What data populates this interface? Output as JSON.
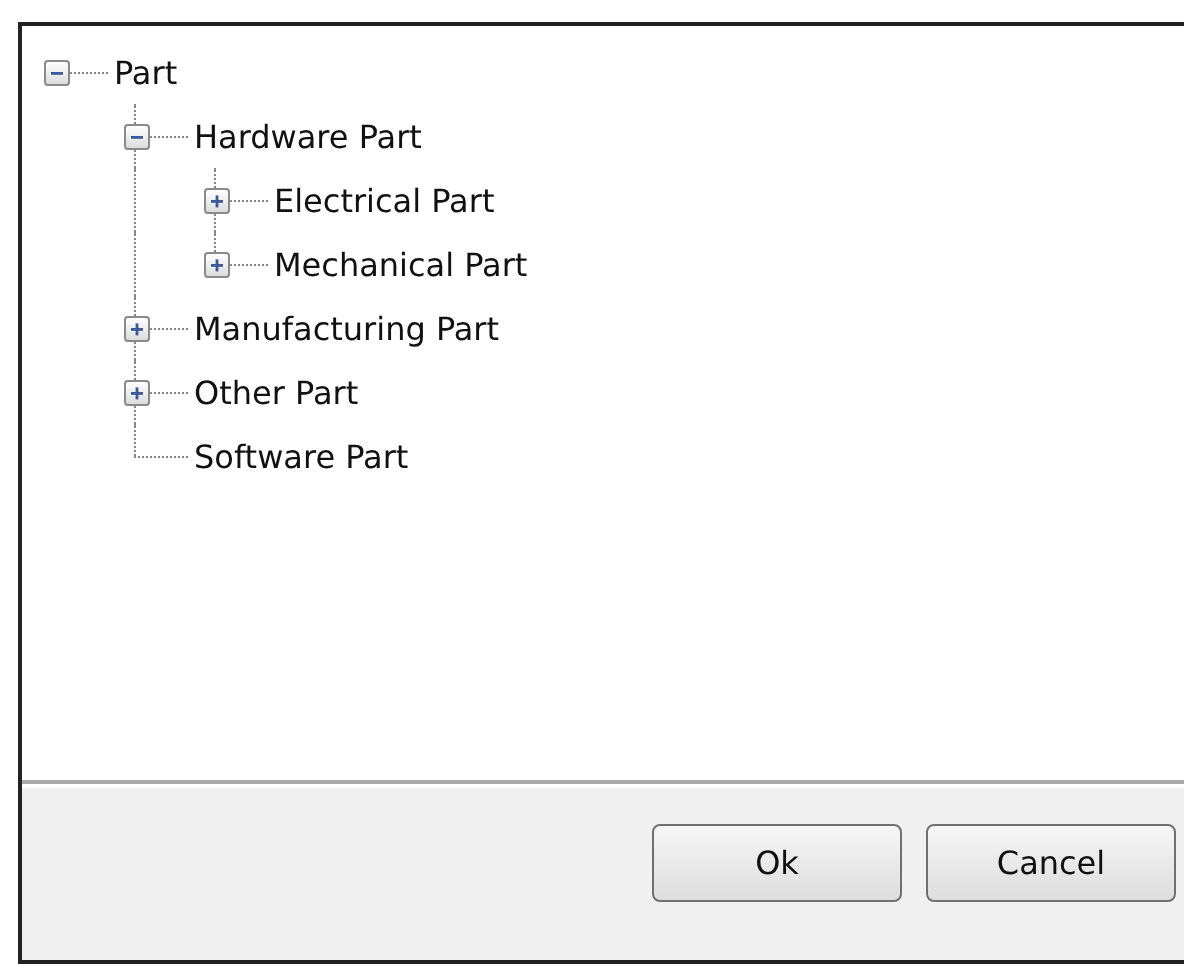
{
  "tree": [
    {
      "label": "Part",
      "expanded": true,
      "children": [
        {
          "label": "Hardware Part",
          "expanded": true,
          "children": [
            {
              "label": "Electrical Part",
              "expanded": false
            },
            {
              "label": "Mechanical Part",
              "expanded": false
            }
          ]
        },
        {
          "label": "Manufacturing Part",
          "expanded": false
        },
        {
          "label": "Other Part",
          "expanded": false
        },
        {
          "label": "Software Part"
        }
      ]
    }
  ],
  "buttons": [
    "Ok",
    "Cancel"
  ]
}
